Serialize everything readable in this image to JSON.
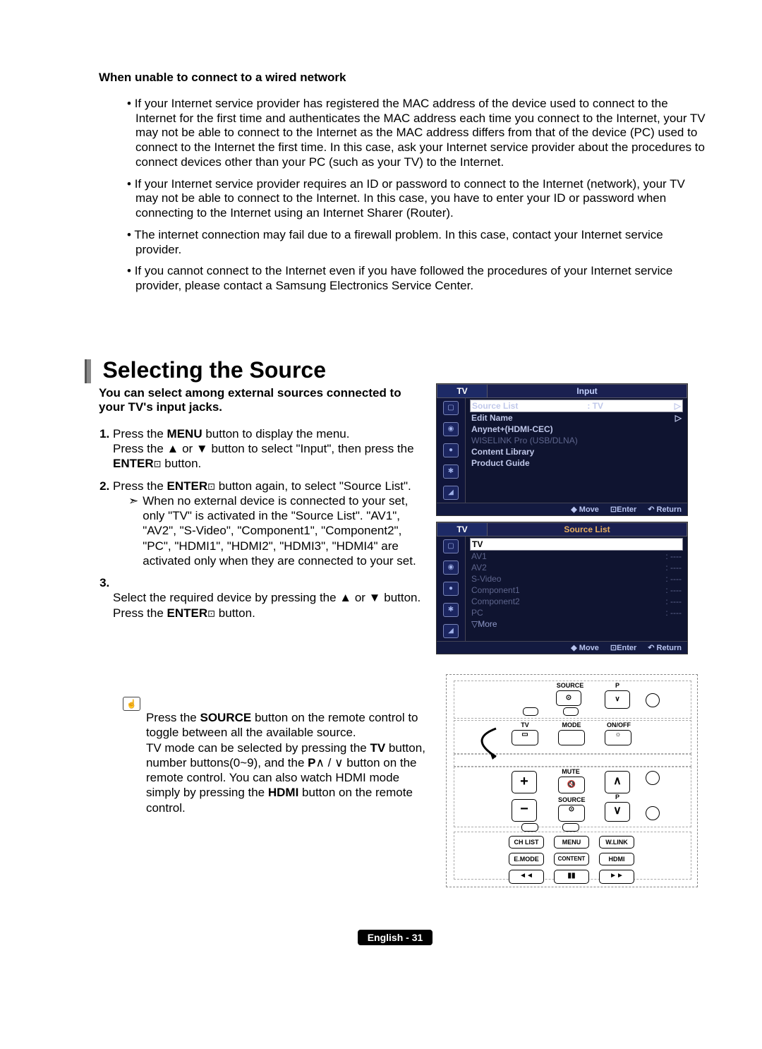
{
  "section1": {
    "heading": "When unable to connect to a wired network",
    "bullets": [
      "If your Internet service provider has registered the MAC address of the device used to connect to the Internet for the first time and authenticates the MAC address each time you connect to the Internet, your TV may not be able to connect to the Internet as the MAC address differs from that of the device (PC) used to connect to the Internet the first time. In this case, ask your Internet service provider about the procedures to connect devices other than your PC (such as your TV) to the Internet.",
      "If your Internet service provider requires an ID or password to connect to the Internet (network), your TV may not be able to connect to the Internet. In this case, you have to enter your ID or password when connecting to the Internet using an Internet Sharer (Router).",
      "The internet connection may fail due to a firewall problem. In this case, contact your Internet service provider.",
      "If you cannot connect to the Internet even if you have followed the procedures of your Internet service provider, please contact a Samsung Electronics Service Center."
    ]
  },
  "section2": {
    "heading": "Selecting the Source",
    "intro": "You can select among external sources connected to your TV's input jacks.",
    "steps": [
      {
        "pre": "Press the ",
        "bold1": "MENU",
        "mid": " button to display the menu.\nPress the ▲ or ▼ button to select \"Input\", then press the ",
        "bold2": "ENTER",
        "post": " button."
      },
      {
        "pre": "Press the ",
        "bold1": "ENTER",
        "post": " button again, to select \"Source List\".",
        "note": "When no external device is connected to your set, only \"TV\" is activated in the \"Source List\". \"AV1\", \"AV2\", \"S-Video\", \"Component1\", \"Component2\", \"PC\", \"HDMI1\", \"HDMI2\", \"HDMI3\", \"HDMI4\" are activated only when they are connected to your set."
      },
      {
        "pre": "Select the required device by pressing the ▲ or ▼ button.\nPress the ",
        "bold1": "ENTER",
        "post": " button."
      }
    ],
    "remote_note": {
      "pre": "Press the ",
      "bold1": "SOURCE",
      "mid1": " button on the remote control to toggle between all the available source.\nTV mode can be selected by pressing the ",
      "bold2": "TV",
      "mid2": " button, number buttons(0~9), and the ",
      "bold3": "P",
      "mid3": "∧ / ∨ button on the remote control. You can also watch HDMI mode simply by pressing the ",
      "bold4": "HDMI",
      "post": " button on the remote control."
    }
  },
  "osd1": {
    "tab": "TV",
    "title": "Input",
    "rows": [
      {
        "label": "Source List",
        "val": ": TV",
        "hi": true,
        "arrow": "▷"
      },
      {
        "label": "Edit Name",
        "val": "",
        "arrow": "▷"
      },
      {
        "label": "Anynet+(HDMI-CEC)",
        "val": ""
      },
      {
        "label": "WISELINK Pro (USB/DLNA)",
        "val": "",
        "dim": true
      },
      {
        "label": "Content Library",
        "val": ""
      },
      {
        "label": "Product Guide",
        "val": ""
      }
    ],
    "footer": {
      "move": "Move",
      "enter": "Enter",
      "ret": "Return"
    }
  },
  "osd2": {
    "tab": "TV",
    "title": "Source List",
    "rows": [
      {
        "label": "TV",
        "val": "",
        "hi": true
      },
      {
        "label": "AV1",
        "val": ": ----",
        "dim": true
      },
      {
        "label": "AV2",
        "val": ": ----",
        "dim": true
      },
      {
        "label": "S-Video",
        "val": ": ----",
        "dim": true
      },
      {
        "label": "Component1",
        "val": ": ----",
        "dim": true
      },
      {
        "label": "Component2",
        "val": ": ----",
        "dim": true
      },
      {
        "label": "PC",
        "val": ": ----",
        "dim": true
      },
      {
        "label": "▽More",
        "val": "",
        "more": true
      }
    ],
    "footer": {
      "move": "Move",
      "enter": "Enter",
      "ret": "Return"
    }
  },
  "remote": {
    "labels": {
      "source": "SOURCE",
      "p": "P",
      "tv": "TV",
      "mode": "MODE",
      "onoff": "ON/OFF",
      "mute": "MUTE",
      "chlist": "CH LIST",
      "menu": "MENU",
      "wlink": "W.LINK",
      "emode": "E.MODE",
      "content": "CONTENT",
      "hdmi": "HDMI"
    }
  },
  "footer": {
    "text": "English - 31"
  },
  "glyphs": {
    "enter": "⊡",
    "up": "▲",
    "down": "▼",
    "noteArrow": "➣",
    "updown": "◆",
    "returnArr": "↶",
    "triDown": "▽",
    "hand": "☝"
  }
}
